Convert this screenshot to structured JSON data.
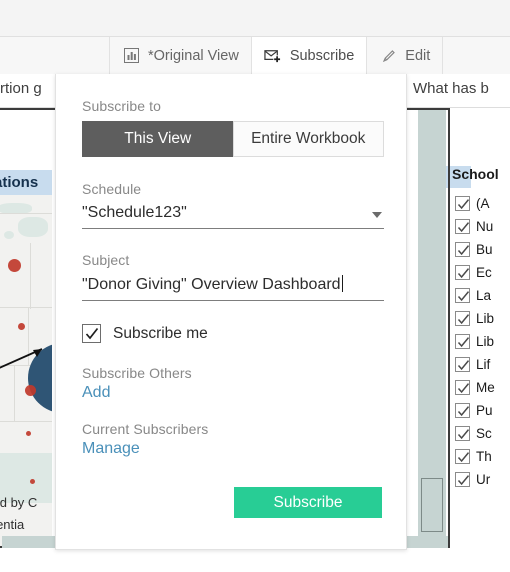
{
  "toolbar": {
    "buttons": [
      {
        "label": "*Original View",
        "icon": "bar-chart-icon",
        "active": false
      },
      {
        "label": "Subscribe",
        "icon": "envelope-plus-icon",
        "active": true
      },
      {
        "label": "Edit",
        "icon": "pencil-icon",
        "active": false
      }
    ]
  },
  "background": {
    "left_text": "rtion g",
    "right_text": "What has b",
    "map_title": "ations",
    "annotation_line1": "ved by C",
    "annotation_line2": "potentia"
  },
  "filter_card": {
    "title": "School",
    "items": [
      {
        "label": "(A",
        "checked": true
      },
      {
        "label": "Nu",
        "checked": true
      },
      {
        "label": "Bu",
        "checked": true
      },
      {
        "label": "Ec",
        "checked": true
      },
      {
        "label": "La",
        "checked": true
      },
      {
        "label": "Lib",
        "checked": true
      },
      {
        "label": "Lib",
        "checked": true
      },
      {
        "label": "Lif",
        "checked": true
      },
      {
        "label": "Me",
        "checked": true
      },
      {
        "label": "Pu",
        "checked": true
      },
      {
        "label": "Sc",
        "checked": true
      },
      {
        "label": "Th",
        "checked": true
      },
      {
        "label": "Ur",
        "checked": true
      }
    ]
  },
  "popover": {
    "subscribe_to": {
      "label": "Subscribe to",
      "options": [
        "This View",
        "Entire Workbook"
      ],
      "selected": "This View"
    },
    "schedule": {
      "label": "Schedule",
      "value": "\"Schedule123\""
    },
    "subject": {
      "label": "Subject",
      "value": "\"Donor Giving\" Overview Dashboard"
    },
    "subscribe_me": {
      "label": "Subscribe me",
      "checked": true
    },
    "subscribe_others": {
      "label": "Subscribe Others",
      "link": "Add"
    },
    "current_subscribers": {
      "label": "Current Subscribers",
      "link": "Manage"
    },
    "submit": {
      "label": "Subscribe",
      "color": "#28cd95"
    }
  },
  "colors": {
    "accent_green": "#28cd95",
    "link_blue": "#4a90b9",
    "selected_gray": "#5e5e5e",
    "header_blue": "#c8dcee",
    "map_dot_red": "#c0392b",
    "map_bubble_blue": "#2f5575"
  }
}
